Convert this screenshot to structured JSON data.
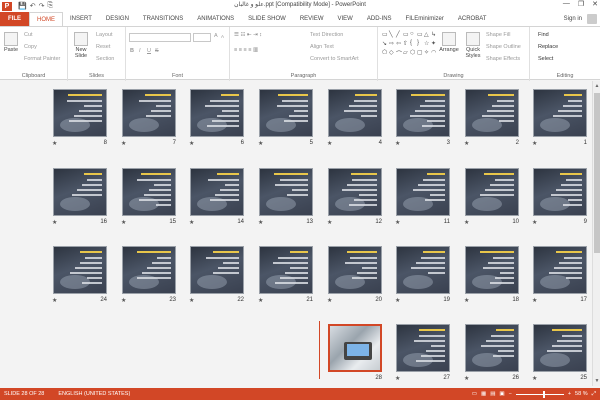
{
  "window": {
    "title": "علو و غالبان.ppt [Compatibility Mode] - PowerPoint",
    "minimize": "—",
    "maximize": "❐",
    "close": "✕"
  },
  "qat": [
    "💾",
    "↶",
    "↷",
    "⎘"
  ],
  "tabs": [
    "FILE",
    "HOME",
    "INSERT",
    "DESIGN",
    "TRANSITIONS",
    "ANIMATIONS",
    "SLIDE SHOW",
    "REVIEW",
    "VIEW",
    "ADD-INS",
    "FILEminimizer",
    "ACROBAT"
  ],
  "active_tab": "HOME",
  "signin": "Sign in",
  "ribbon": {
    "clipboard": {
      "label": "Clipboard",
      "paste": "Paste",
      "cut": "Cut",
      "copy": "Copy",
      "format_painter": "Format Painter"
    },
    "slides": {
      "label": "Slides",
      "new_slide": "New Slide",
      "layout": "Layout",
      "reset": "Reset",
      "section": "Section"
    },
    "font": {
      "label": "Font",
      "bold": "B",
      "italic": "I",
      "underline": "U",
      "strike": "S",
      "grow": "A",
      "shrink": "A"
    },
    "paragraph": {
      "label": "Paragraph",
      "text_direction": "Text Direction",
      "align_text": "Align Text",
      "smartart": "Convert to SmartArt"
    },
    "drawing": {
      "label": "Drawing",
      "arrange": "Arrange",
      "quick_styles": "Quick Styles",
      "shape_fill": "Shape Fill",
      "shape_outline": "Shape Outline",
      "shape_effects": "Shape Effects"
    },
    "editing": {
      "label": "Editing",
      "find": "Find",
      "replace": "Replace",
      "select": "Select"
    }
  },
  "slides": [
    {
      "n": "1",
      "star": "★"
    },
    {
      "n": "2",
      "star": "★"
    },
    {
      "n": "3",
      "star": "★"
    },
    {
      "n": "4",
      "star": "★"
    },
    {
      "n": "5",
      "star": "★"
    },
    {
      "n": "6",
      "star": "★"
    },
    {
      "n": "7",
      "star": "★"
    },
    {
      "n": "8",
      "star": "★"
    },
    {
      "n": "9",
      "star": "★"
    },
    {
      "n": "10",
      "star": "★"
    },
    {
      "n": "11",
      "star": "★"
    },
    {
      "n": "12",
      "star": "★"
    },
    {
      "n": "13",
      "star": "★"
    },
    {
      "n": "14",
      "star": "★"
    },
    {
      "n": "15",
      "star": "★"
    },
    {
      "n": "16",
      "star": "★"
    },
    {
      "n": "17",
      "star": "★"
    },
    {
      "n": "18",
      "star": "★"
    },
    {
      "n": "19",
      "star": "★"
    },
    {
      "n": "20",
      "star": "★"
    },
    {
      "n": "21",
      "star": "★"
    },
    {
      "n": "22",
      "star": "★"
    },
    {
      "n": "23",
      "star": "★"
    },
    {
      "n": "24",
      "star": "★"
    },
    {
      "n": "25",
      "star": "★"
    },
    {
      "n": "26",
      "star": "★"
    },
    {
      "n": "27",
      "star": "★"
    },
    {
      "n": "28",
      "star": ""
    }
  ],
  "status": {
    "slide_indicator": "SLIDE 28 OF 28",
    "language": "ENGLISH (UNITED STATES)",
    "zoom": "58 %",
    "zoom_fraction": 0.58,
    "minus": "−",
    "plus": "+"
  },
  "colors": {
    "accent": "#d24726"
  }
}
